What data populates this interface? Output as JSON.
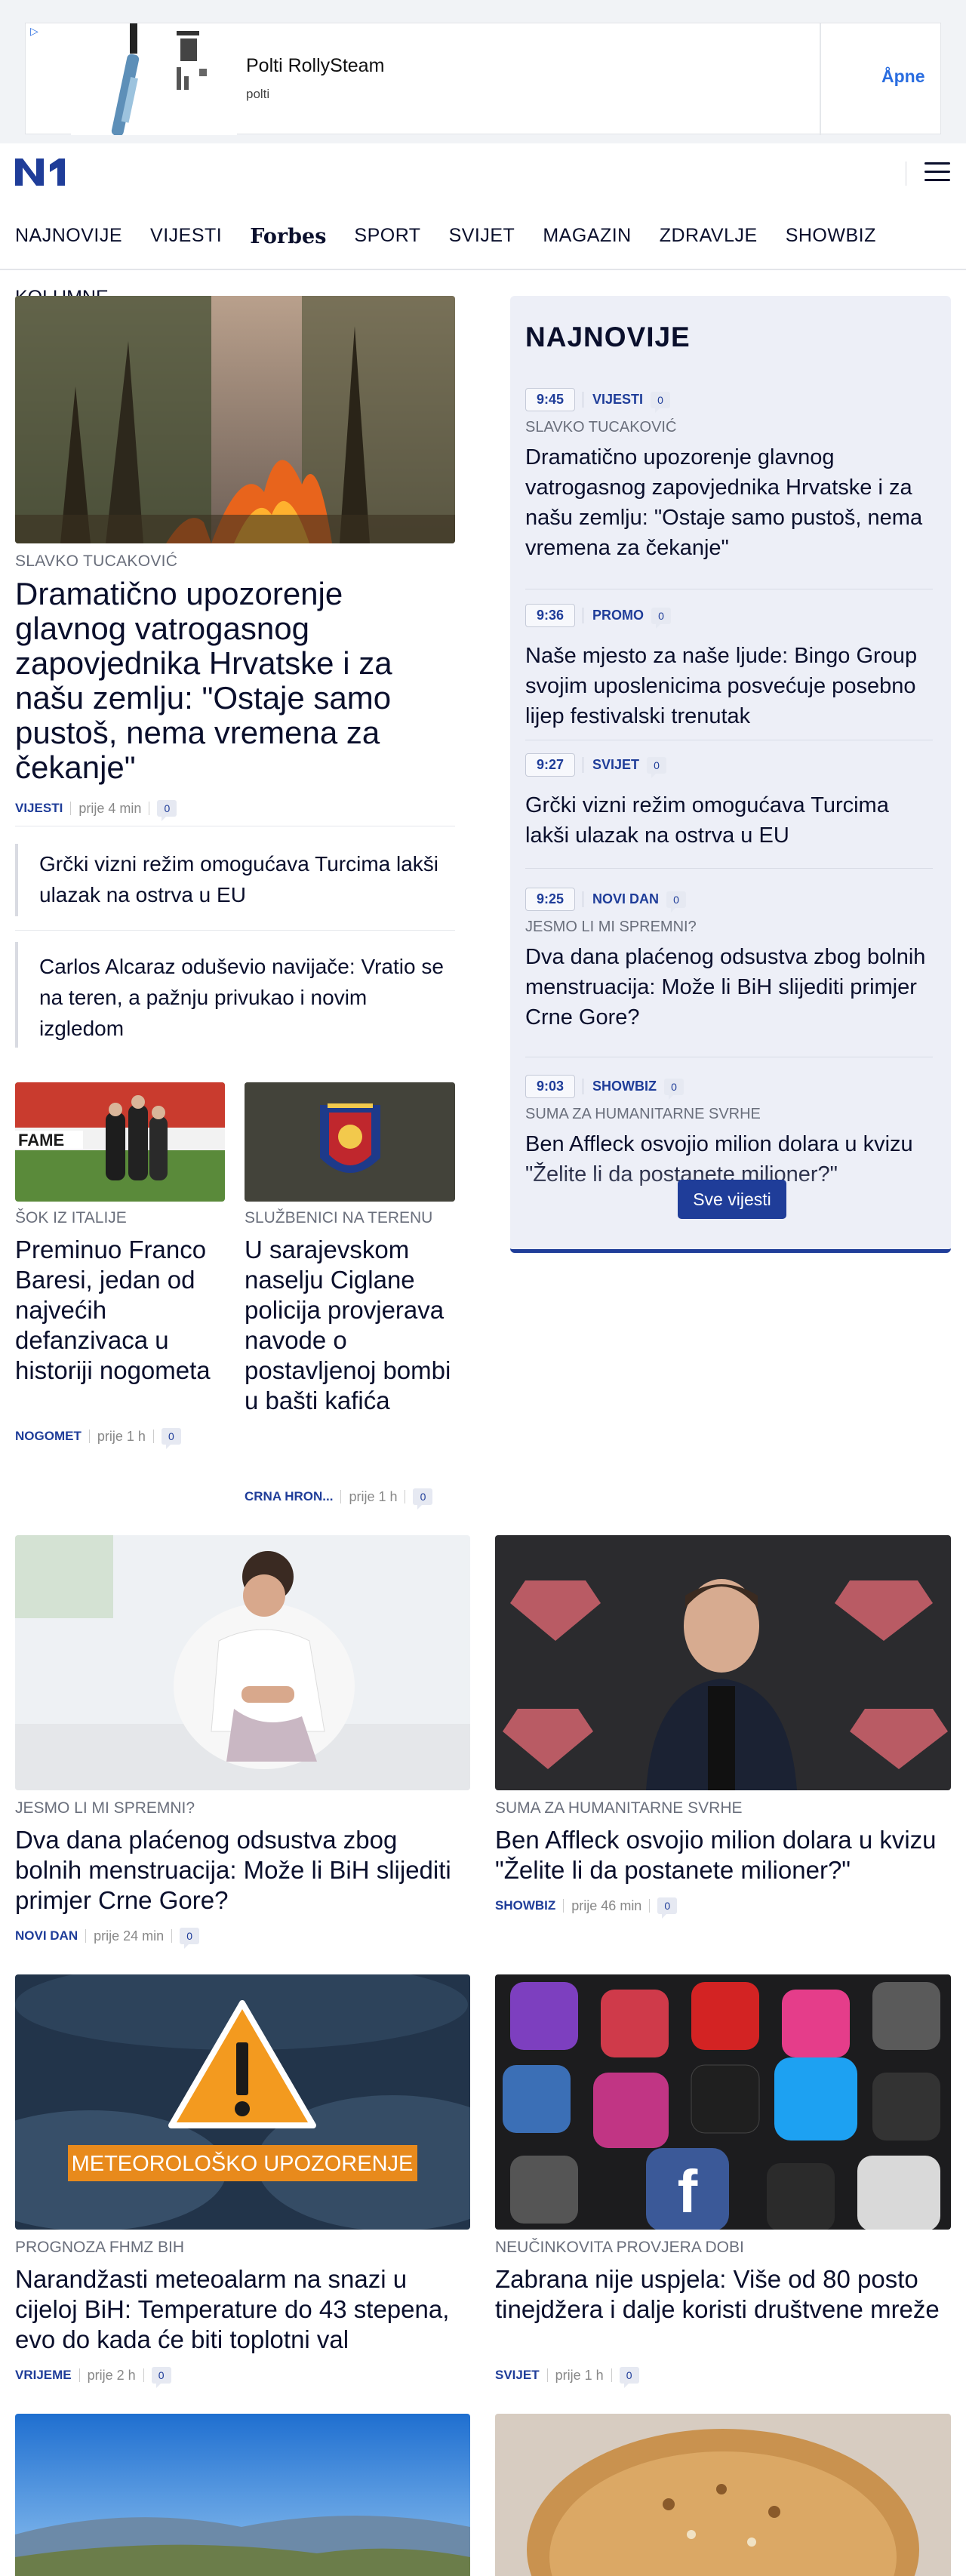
{
  "ad": {
    "title": "Polti RollySteam",
    "advertiser": "polti",
    "cta": "Åpne"
  },
  "header": {
    "logo": "N1"
  },
  "nav": {
    "items": [
      "NAJNOVIJE",
      "VIJESTI",
      "Forbes",
      "SPORT",
      "SVIJET",
      "MAGAZIN",
      "ZDRAVLJE",
      "SHOWBIZ"
    ],
    "second_row": "KOLUMNE"
  },
  "lead": {
    "kicker": "SLAVKO TUCAKOVIĆ",
    "headline": "Dramatično upozorenje glavnog vatrogasnog zapovjednika Hrvatske i za našu zemlju: \"Ostaje samo pustoš, nema vremena za čekanje\"",
    "category": "VIJESTI",
    "time": "prije 4 min",
    "comments": "0",
    "related": [
      "Grčki vizni režim omogućava Turcima lakši ulazak na ostrva u EU",
      "Carlos Alcaraz oduševio navijače: Vratio se na teren, a pažnju privukao i novim izgledom"
    ]
  },
  "small_cards": [
    {
      "kicker": "ŠOK IZ ITALIJE",
      "headline": "Preminuo Franco Baresi, jedan od najvećih defanzivaca u historiji nogometa",
      "category": "NOGOMET",
      "time": "prije 1 h",
      "comments": "0"
    },
    {
      "kicker": "SLUŽBENICI NA TERENU",
      "headline": "U sarajevskom naselju Ciglane policija provjerava navode o postavljenoj bombi u bašti kafića",
      "category": "CRNA HRON...",
      "time": "prije 1 h",
      "comments": "0"
    }
  ],
  "sidebar": {
    "title": "NAJNOVIJE",
    "button": "Sve vijesti",
    "items": [
      {
        "time": "9:45",
        "category": "VIJESTI",
        "comments": "0",
        "kicker": "SLAVKO TUCAKOVIĆ",
        "headline": "Dramatično upozorenje glavnog vatrogasnog zapovjednika Hrvatske i za našu zemlju: \"Ostaje samo pustoš, nema vremena za čekanje\""
      },
      {
        "time": "9:36",
        "category": "PROMO",
        "comments": "0",
        "kicker": "",
        "headline": "Naše mjesto za naše ljude: Bingo Group svojim uposlenicima posvećuje posebno lijep festivalski trenutak"
      },
      {
        "time": "9:27",
        "category": "SVIJET",
        "comments": "0",
        "kicker": "",
        "headline": "Grčki vizni režim omogućava Turcima lakši ulazak na ostrva u EU"
      },
      {
        "time": "9:25",
        "category": "NOVI DAN",
        "comments": "0",
        "kicker": "JESMO LI MI SPREMNI?",
        "headline": "Dva dana plaćenog odsustva zbog bolnih menstruacija: Može li BiH slijediti primjer Crne Gore?"
      },
      {
        "time": "9:03",
        "category": "SHOWBIZ",
        "comments": "0",
        "kicker": "SUMA ZA HUMANITARNE SVRHE",
        "headline": "Ben Affleck osvojio milion dolara u kvizu \"Želite li da postanete milioner?\""
      }
    ]
  },
  "grid": [
    {
      "kicker": "JESMO LI MI SPREMNI?",
      "headline": "Dva dana plaćenog odsustva zbog bolnih menstruacija: Može li BiH slijediti primjer Crne Gore?",
      "category": "NOVI DAN",
      "time": "prije 24 min",
      "comments": "0"
    },
    {
      "kicker": "SUMA ZA HUMANITARNE SVRHE",
      "headline": "Ben Affleck osvojio milion dolara u kvizu \"Želite li da postanete milioner?\"",
      "category": "SHOWBIZ",
      "time": "prije 46 min",
      "comments": "0"
    },
    {
      "kicker": "PROGNOZA FHMZ BIH",
      "headline": "Narandžasti meteoalarm na snazi u cijeloj BiH: Temperature do 43 stepena, evo do kada će biti toplotni val",
      "category": "VRIJEME",
      "time": "prije 2 h",
      "comments": "0",
      "image_text": "METEOROLOŠKO UPOZORENJE"
    },
    {
      "kicker": "NEUČINKOVITA PROVJERA DOBI",
      "headline": "Zabrana nije uspjela: Više od 80 posto tinejdžera i dalje koristi društvene mreže",
      "category": "SVIJET",
      "time": "prije 1 h",
      "comments": "0"
    }
  ],
  "colors": {
    "brand": "#1f3d99",
    "sidebar_bg": "#edeff7",
    "text": "#0a0f2c"
  }
}
